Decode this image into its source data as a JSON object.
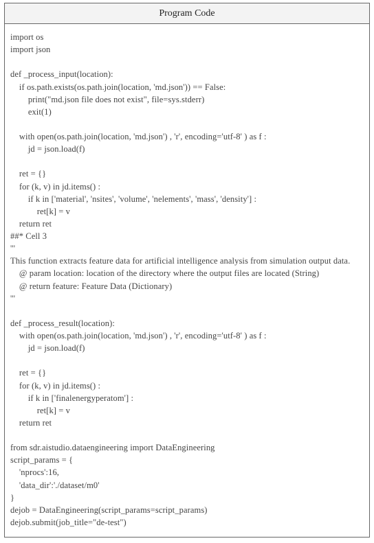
{
  "title": "Program Code",
  "code": "import os\nimport json\n\ndef _process_input(location):\n    if os.path.exists(os.path.join(location, 'md.json')) == False:\n        print(\"md.json file does not exist\", file=sys.stderr)\n        exit(1)\n\n    with open(os.path.join(location, 'md.json') , 'r', encoding='utf-8' ) as f :\n        jd = json.load(f)\n\n    ret = {}\n    for (k, v) in jd.items() :\n        if k in ['material', 'nsites', 'volume', 'nelements', 'mass', 'density'] :\n            ret[k] = v\n    return ret\n##* Cell 3\n'''\nThis function extracts feature data for artificial intelligence analysis from simulation output data.\n    @ param location: location of the directory where the output files are located (String)\n    @ return feature: Feature Data (Dictionary)\n'''\n\ndef _process_result(location):\n    with open(os.path.join(location, 'md.json') , 'r', encoding='utf-8' ) as f :\n        jd = json.load(f)\n\n    ret = {}\n    for (k, v) in jd.items() :\n        if k in ['finalenergyperatom'] :\n            ret[k] = v\n    return ret\n\nfrom sdr.aistudio.dataengineering import DataEngineering\nscript_params = {\n    'nprocs':16,\n    'data_dir':'./dataset/m0'\n}\ndejob = DataEngineering(script_params=script_params)\ndejob.submit(job_title=\"de-test\")"
}
